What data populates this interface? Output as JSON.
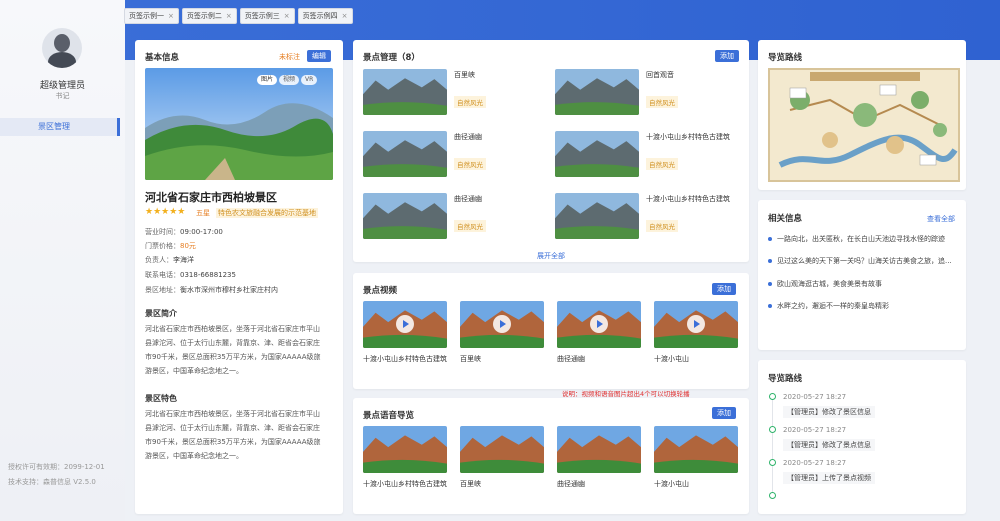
{
  "sidebar": {
    "user_name": "超级管理员",
    "user_role": "书记",
    "menu_item": "景区管理",
    "footer_license": "授权许可有效期：2099-12-01",
    "footer_support": "技术支持：森普信息  V2.5.0"
  },
  "tabs": [
    {
      "label": "页签示例一",
      "close": "×"
    },
    {
      "label": "页签示例二",
      "close": "×"
    },
    {
      "label": "页签示例三",
      "close": "×"
    },
    {
      "label": "页签示例四",
      "close": "×"
    }
  ],
  "basic": {
    "title": "基本信息",
    "status": "未标注",
    "edit": "编辑",
    "pills": [
      "图片",
      "视频",
      "VR"
    ],
    "name": "河北省石家庄市西柏坡景区",
    "stars": "★★★★★",
    "level": "五星",
    "tagline": "特色农文旅融合发展的示范基地",
    "hours_label": "营业时间：",
    "hours": "09:00-17:00",
    "price_label": "门票价格：",
    "price": "80元",
    "manager_label": "负责人：",
    "manager": "李海洋",
    "phone_label": "联系电话：",
    "phone": "0318-66881235",
    "address_label": "景区地址：",
    "address": "衡水市深州市穆村乡杜家庄村内",
    "intro_title": "景区简介",
    "intro_lines": [
      "河北省石家庄市西柏坡景区，坐落于河北省石家庄市平山",
      "县滹沱河、位于太行山东麓，背靠京、津、距省会石家庄",
      "市90千米，景区总面积35万平方米，为国家AAAAA级旅",
      "游景区，中国革命纪念地之一。"
    ],
    "feature_title": "景区特色",
    "feature_lines": [
      "河北省石家庄市西柏坡景区，坐落于河北省石家庄市平山",
      "县滹沱河、位于太行山东麓，背靠京、津、距省会石家庄",
      "市90千米，景区总面积35万平方米，为国家AAAAA级旅",
      "游景区，中国革命纪念地之一。"
    ]
  },
  "spots": {
    "title": "景点管理（8）",
    "add": "添加",
    "more": "展开全部",
    "items": [
      {
        "name": "百里峡",
        "tag": "自然风光"
      },
      {
        "name": "回首观音",
        "tag": "自然风光"
      },
      {
        "name": "曲径通幽",
        "tag": "自然风光"
      },
      {
        "name": "十渡小屯山乡村特色古建筑",
        "tag": "自然风光"
      },
      {
        "name": "曲径通幽",
        "tag": "自然风光"
      },
      {
        "name": "十渡小屯山乡村特色古建筑",
        "tag": "自然风光"
      }
    ]
  },
  "videos": {
    "title": "景点视频",
    "add": "添加",
    "items": [
      "十渡小屯山乡村特色古建筑",
      "百里峡",
      "曲径通幽",
      "十渡小屯山"
    ]
  },
  "note": "说明：视频和语音图片超出4个可以切换轮播",
  "audio": {
    "title": "景点语音导览",
    "add": "添加",
    "items": [
      "十渡小屯山乡村特色古建筑",
      "百里峡",
      "曲径通幽",
      "十渡小屯山"
    ]
  },
  "route_map": {
    "title": "导览路线"
  },
  "related": {
    "title": "相关信息",
    "view_all": "查看全部",
    "items": [
      "一路向北，出关匿秋，在长白山天池边寻找水怪的踪迹",
      "见过这么美的天下第一关吗？山海关访古美食之旅，追...",
      "欧山观海逛古城，美食美景有故事",
      "水畔之约，邂逅不一样的秦皇岛精彩"
    ]
  },
  "route_log": {
    "title": "导览路线",
    "entries": [
      {
        "time": "2020-05-27  18:27",
        "text": "【管理员】修改了景区信息"
      },
      {
        "time": "2020-05-27  18:27",
        "text": "【管理员】修改了景点信息"
      },
      {
        "time": "2020-05-27  18:27",
        "text": "【管理员】上传了景点视频"
      }
    ]
  },
  "colors": {
    "accent": "#3b6fd8",
    "tag_bg": "#fdf3dc",
    "tag_text": "#d09020",
    "timeline": "#2fb36b",
    "warning": "#e03030"
  }
}
